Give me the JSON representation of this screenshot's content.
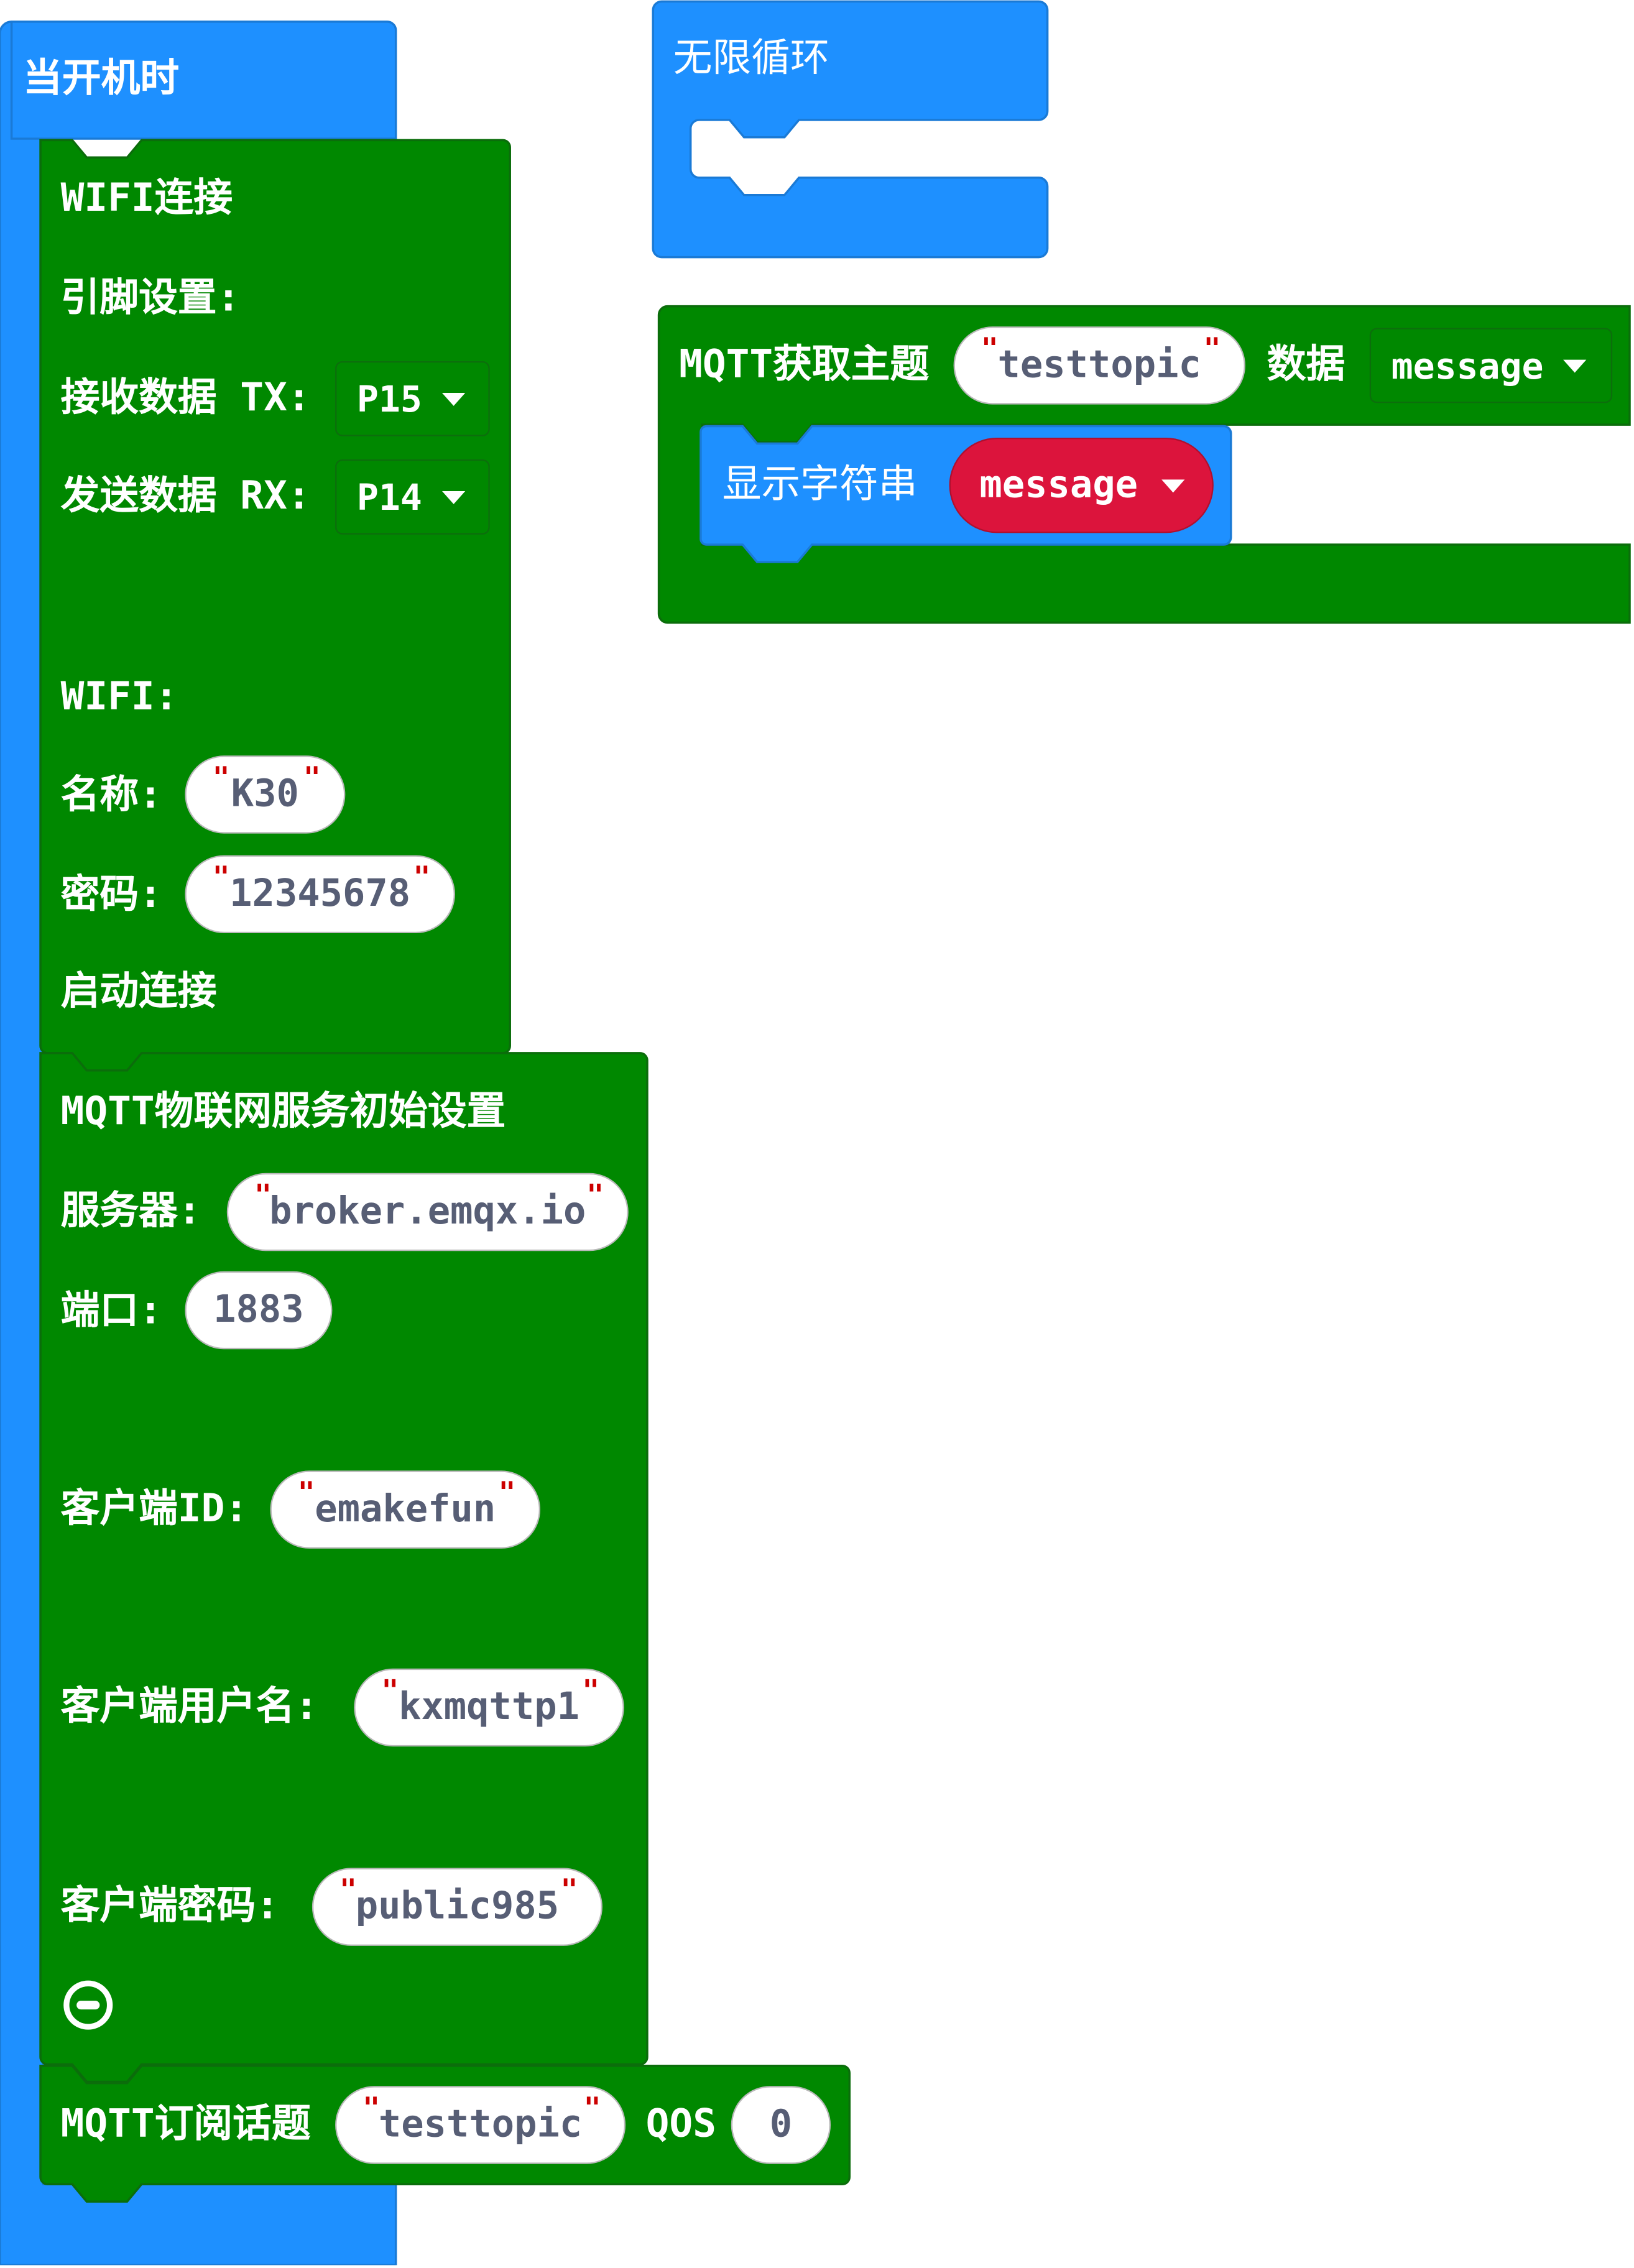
{
  "colors": {
    "event_block": "#1e90ff",
    "iot_block": "#008800",
    "variable_block": "#dc143c"
  },
  "on_start": {
    "label": "当开机时",
    "wifi_connect": {
      "title": "WIFI连接",
      "pin_settings_label": "引脚设置:",
      "rx_label": "接收数据 TX:",
      "rx_pin": "P15",
      "tx_label": "发送数据 RX:",
      "tx_pin": "P14",
      "wifi_label": "WIFI:",
      "name_label": "名称:",
      "name_value": "K30",
      "password_label": "密码:",
      "password_value": "12345678",
      "start_label": "启动连接"
    },
    "mqtt_init": {
      "title": "MQTT物联网服务初始设置",
      "server_label": "服务器:",
      "server_value": "broker.emqx.io",
      "port_label": "端口:",
      "port_value": "1883",
      "client_id_label": "客户端ID:",
      "client_id_value": "emakefun",
      "username_label": "客户端用户名:",
      "username_value": "kxmqttp1",
      "password_label": "客户端密码:",
      "password_value": "public985",
      "remove_icon": "minus-circle-icon"
    },
    "mqtt_subscribe": {
      "label": "MQTT订阅话题",
      "topic": "testtopic",
      "qos_label": "QOS",
      "qos_value": "0"
    }
  },
  "forever": {
    "label": "无限循环"
  },
  "mqtt_receive": {
    "label": "MQTT获取主题",
    "topic": "testtopic",
    "data_label": "数据",
    "variable": "message",
    "show_string": {
      "label": "显示字符串",
      "variable": "message"
    }
  }
}
